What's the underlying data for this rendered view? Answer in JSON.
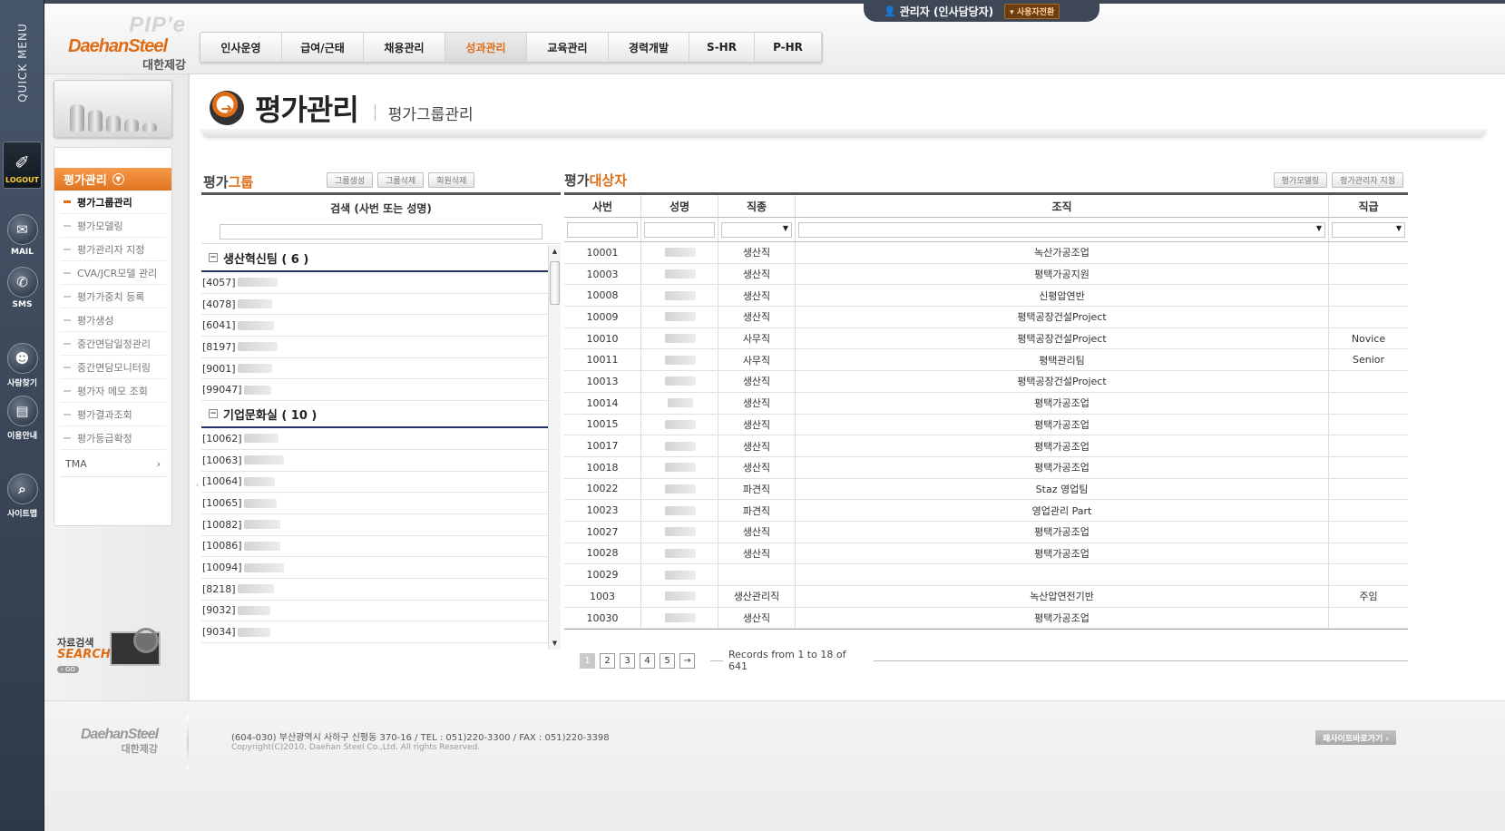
{
  "quick_menu": {
    "title": "QUICK MENU",
    "logout": "LOGOUT",
    "items": [
      "MAIL",
      "SMS",
      "사람찾기",
      "이용안내",
      "사이트맵"
    ]
  },
  "logo": {
    "pipe": "PIP'e",
    "brand": "DaehanSteel",
    "korean": "대한제강"
  },
  "user": {
    "name": "관리자 (인사담당자)",
    "switch_label": "사용자전환"
  },
  "gnb": {
    "items": [
      "인사운영",
      "급여/근태",
      "채용관리",
      "성과관리",
      "교육관리",
      "경력개발",
      "S-HR",
      "P-HR"
    ],
    "active": "성과관리"
  },
  "lnb": {
    "title": "평가관리",
    "items": [
      "평가그룹관리",
      "평가모델링",
      "평가관리자 지정",
      "CVA/JCR모델 관리",
      "평가가중치 등록",
      "평가생성",
      "중간면담일정관리",
      "중간면담모니터링",
      "평가자 메모 조회",
      "평가결과조회",
      "평가등급확정"
    ],
    "current": "평가그룹관리",
    "extra": "TMA"
  },
  "search_banner": {
    "label": "자료검색",
    "title": "SEARCH",
    "go": "› GO"
  },
  "page": {
    "title": "평가관리",
    "subtitle": "평가그룹관리"
  },
  "group_panel": {
    "title_prefix": "평가",
    "title_accent": "그룹",
    "buttons": [
      "그룹생성",
      "그룹삭제",
      "회원삭제"
    ],
    "search_label": "검색 (사번 또는 성명)",
    "search_value": "",
    "groups": [
      {
        "name": "생산혁신팀 ( 6 )",
        "members": [
          "[4057]",
          "[4078]",
          "[6041]",
          "[8197]",
          "[9001]",
          "[99047]"
        ]
      },
      {
        "name": "기업문화실 ( 10 )",
        "members": [
          "[10062]",
          "[10063]",
          "[10064]",
          "[10065]",
          "[10082]",
          "[10086]",
          "[10094]",
          "[8218]",
          "[9032]",
          "[9034]"
        ]
      }
    ]
  },
  "target_panel": {
    "title_prefix": "평가",
    "title_accent": "대상자",
    "buttons": [
      "평가모델링",
      "평가관리자 지정"
    ],
    "columns": [
      "사번",
      "성명",
      "직종",
      "조직",
      "직급"
    ],
    "rows": [
      {
        "id": "10001",
        "type": "생산직",
        "org": "녹산가공조업",
        "grade": ""
      },
      {
        "id": "10003",
        "type": "생산직",
        "org": "평택가공지원",
        "grade": ""
      },
      {
        "id": "10008",
        "type": "생산직",
        "org": "신평압연반",
        "grade": ""
      },
      {
        "id": "10009",
        "type": "생산직",
        "org": "평택공장건설Project",
        "grade": ""
      },
      {
        "id": "10010",
        "type": "사무직",
        "org": "평택공장건설Project",
        "grade": "Novice"
      },
      {
        "id": "10011",
        "type": "사무직",
        "org": "평택관리팀",
        "grade": "Senior"
      },
      {
        "id": "10013",
        "type": "생산직",
        "org": "평택공장건설Project",
        "grade": ""
      },
      {
        "id": "10014",
        "type": "생산직",
        "org": "평택가공조업",
        "grade": ""
      },
      {
        "id": "10015",
        "type": "생산직",
        "org": "평택가공조업",
        "grade": ""
      },
      {
        "id": "10017",
        "type": "생산직",
        "org": "평택가공조업",
        "grade": ""
      },
      {
        "id": "10018",
        "type": "생산직",
        "org": "평택가공조업",
        "grade": ""
      },
      {
        "id": "10022",
        "type": "파견직",
        "org": "Staz 영업팀",
        "grade": ""
      },
      {
        "id": "10023",
        "type": "파견직",
        "org": "영업관리 Part",
        "grade": ""
      },
      {
        "id": "10027",
        "type": "생산직",
        "org": "평택가공조업",
        "grade": ""
      },
      {
        "id": "10028",
        "type": "생산직",
        "org": "평택가공조업",
        "grade": ""
      },
      {
        "id": "10029",
        "type": "",
        "org": "",
        "grade": ""
      },
      {
        "id": "1003",
        "type": "생산관리직",
        "org": "녹산압연전기반",
        "grade": "주임"
      },
      {
        "id": "10030",
        "type": "생산직",
        "org": "평택가공조업",
        "grade": ""
      }
    ],
    "pages": [
      "1",
      "2",
      "3",
      "4",
      "5",
      "→"
    ],
    "current_page": "1",
    "records": "Records from 1 to 18 of 641"
  },
  "footer": {
    "brand": "DaehanSteel",
    "brand_kr": "대한제강",
    "address": "(604-030) 부산광역시 사하구 신평동 370-16   /   TEL : 051)220-3300   /   FAX : 051)220-3398",
    "copyright": "Copyright(C)2010, Daehan Steel Co.,Ltd. All rights Reserved.",
    "site_button": "패사이트바로가기 ›"
  },
  "colors": {
    "accent": "#e06d16",
    "sidebar": "#3d4756",
    "group_line": "#243468"
  }
}
